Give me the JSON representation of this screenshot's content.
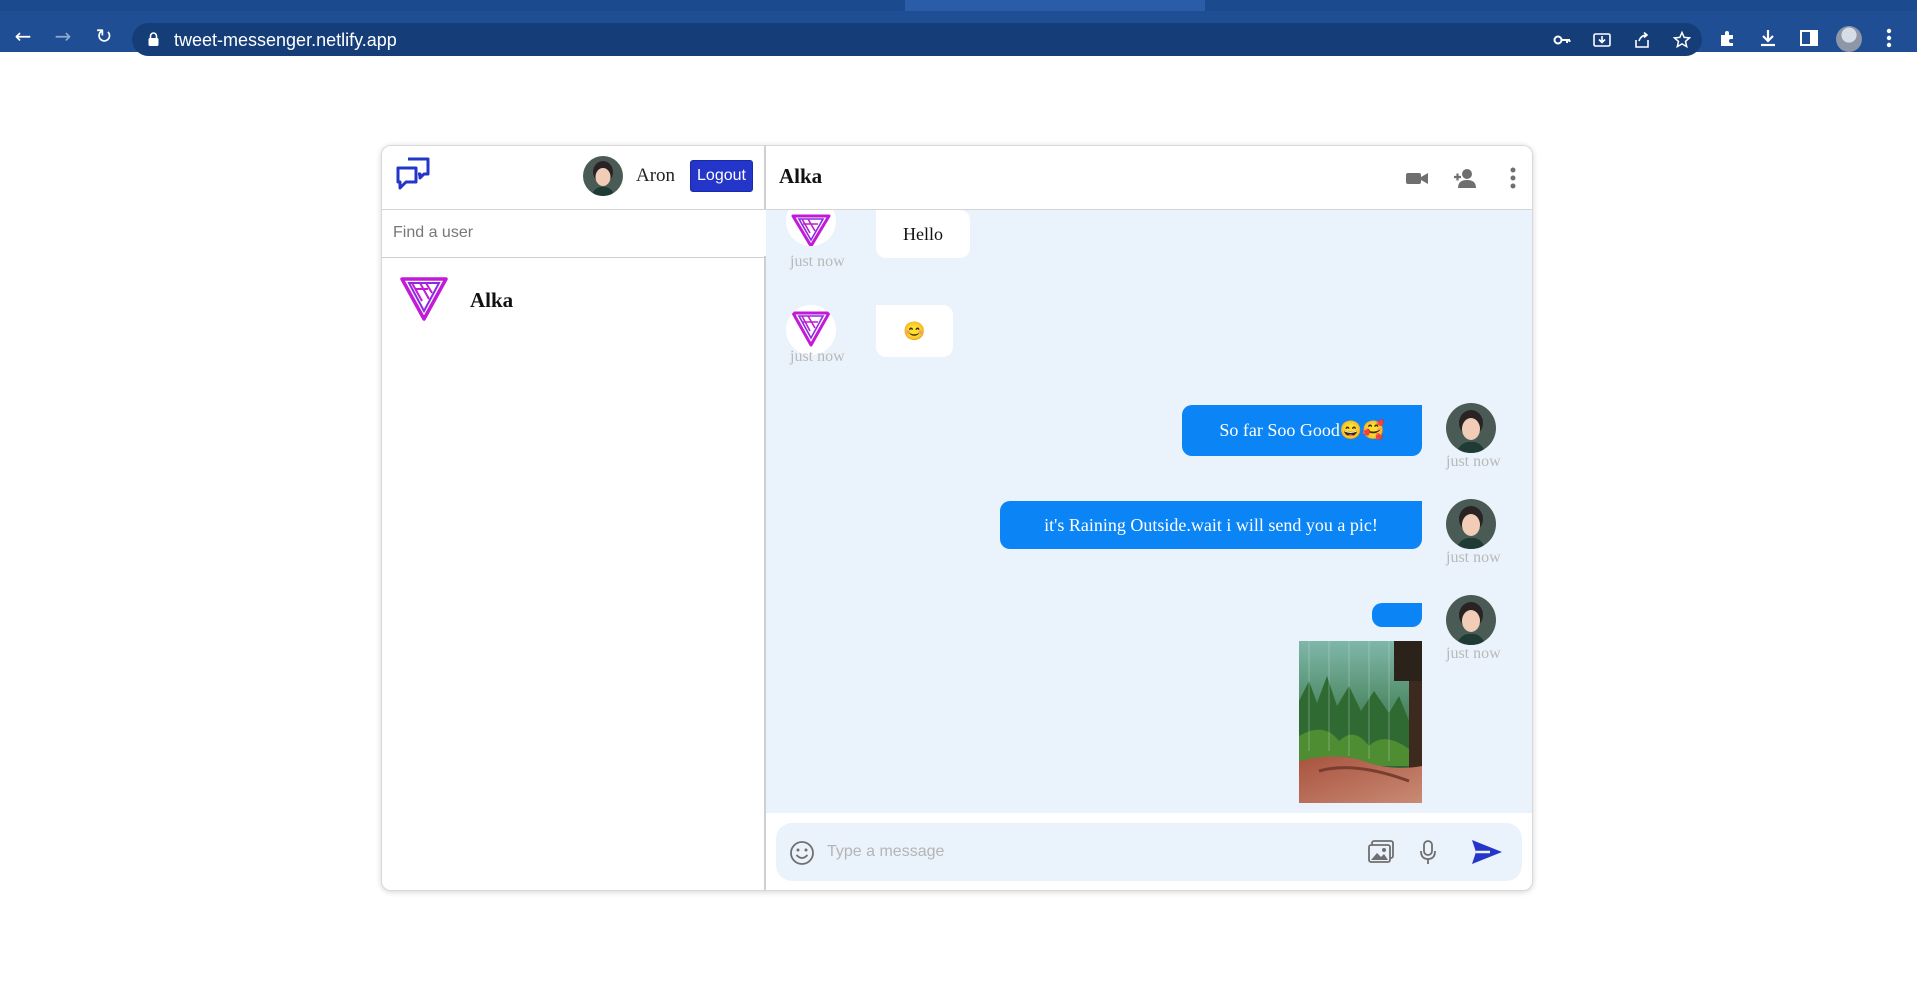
{
  "browser": {
    "url": "tweet-messenger.netlify.app"
  },
  "sidebar": {
    "current_user": {
      "name": "Aron"
    },
    "logout_label": "Logout",
    "search_placeholder": "Find a user",
    "users": [
      {
        "name": "Alka"
      }
    ]
  },
  "chat": {
    "title": "Alka",
    "messages": [
      {
        "direction": "in",
        "text": "Hello",
        "time": "just now"
      },
      {
        "direction": "in",
        "text": "😊",
        "time": "just now"
      },
      {
        "direction": "out",
        "text": "So far Soo Good😄🥰",
        "time": "just now"
      },
      {
        "direction": "out",
        "text": "it's Raining Outside.wait i will send you a pic!",
        "time": "just now"
      },
      {
        "direction": "out",
        "text": "",
        "time": "just now",
        "image": "rain-forest-photo"
      }
    ],
    "composer": {
      "placeholder": "Type a message"
    }
  },
  "colors": {
    "brand_blue": "#2435c9",
    "outgoing_bubble": "#0b84f5",
    "chat_background": "#eaf2fb",
    "chrome_blue": "#1f4e94"
  },
  "icons": {
    "app_logo": "chat-bubbles-icon",
    "video": "video-camera-icon",
    "add_user": "add-user-icon",
    "more": "more-vertical-icon",
    "emoji": "emoji-icon",
    "attach_image": "image-icon",
    "microphone": "microphone-icon",
    "send": "send-icon"
  }
}
